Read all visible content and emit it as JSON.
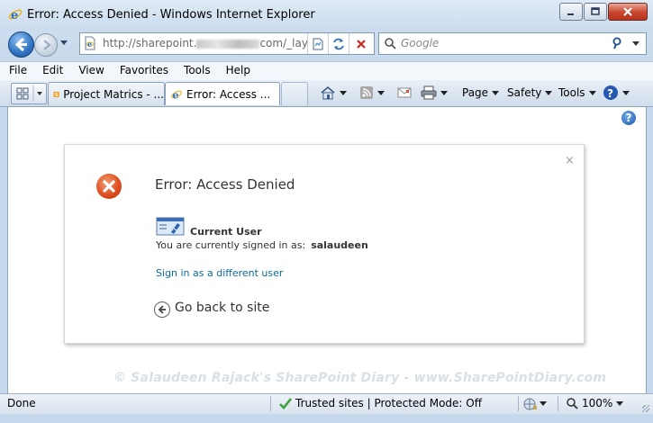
{
  "window": {
    "title": "Error: Access Denied - Windows Internet Explorer"
  },
  "address_bar": {
    "url_start": "http://sharepoint.",
    "url_end": "com/_lay"
  },
  "search": {
    "placeholder": "Google"
  },
  "menu": {
    "items": [
      "File",
      "Edit",
      "View",
      "Favorites",
      "Tools",
      "Help"
    ]
  },
  "tabs": [
    {
      "label": "Project Matrics - ...",
      "active": false
    },
    {
      "label": "Error: Access ...",
      "active": true
    }
  ],
  "command_bar": {
    "page": "Page",
    "safety": "Safety",
    "tools": "Tools"
  },
  "error_page": {
    "title": "Error: Access Denied",
    "current_user_label": "Current User",
    "signed_in_text": "You are currently signed in as:",
    "username": "salaudeen",
    "sign_in_link": "Sign in as a different user",
    "go_back": "Go back to site",
    "close_symbol": "×"
  },
  "watermark": "© Salaudeen Rajack's SharePoint Diary - www.SharePointDiary.com",
  "status_bar": {
    "status": "Done",
    "zone": "Trusted sites | Protected Mode: Off",
    "zoom": "100%"
  },
  "colors": {
    "error_icon": "#dc4a1d",
    "link": "#0a6b9c",
    "trusted_check": "#3da03d"
  }
}
